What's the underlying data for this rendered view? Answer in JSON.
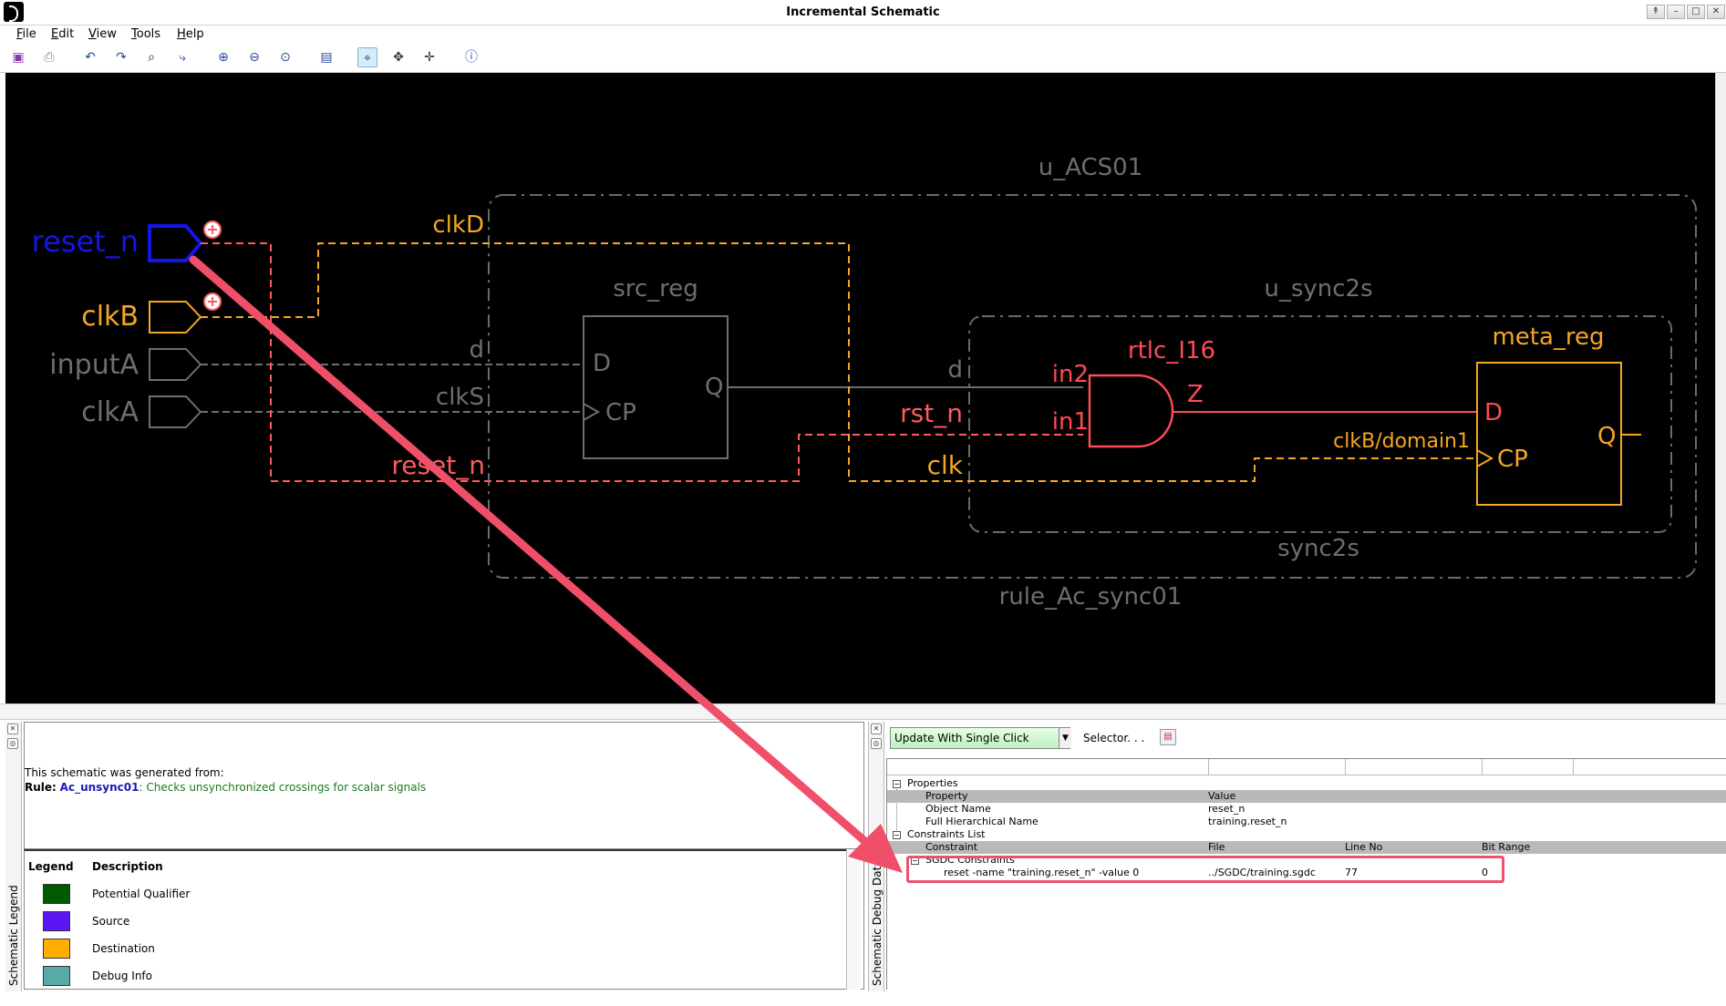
{
  "window": {
    "title": "Incremental Schematic"
  },
  "menu": [
    {
      "label": "File",
      "u": "F",
      "rest": "ile"
    },
    {
      "label": "Edit",
      "u": "E",
      "rest": "dit"
    },
    {
      "label": "View",
      "u": "V",
      "rest": "iew"
    },
    {
      "label": "Tools",
      "u": "T",
      "rest": "ools"
    },
    {
      "label": "Help",
      "u": "H",
      "rest": "elp"
    }
  ],
  "toolbar": {
    "icons": [
      "save-icon",
      "print-icon",
      "undo-icon",
      "redo-icon",
      "find-icon",
      "trace-icon",
      "zoom-in-icon",
      "zoom-out-icon",
      "zoom-fit-icon",
      "window-icon",
      "select-icon",
      "pan-icon",
      "move-icon",
      "info-icon"
    ]
  },
  "schematic": {
    "ports": {
      "reset_n": "reset_n",
      "clkB": "clkB",
      "inputA": "inputA",
      "clkA": "clkA"
    },
    "blocks": {
      "u_acs01": "u_ACS01",
      "rule": "rule_Ac_sync01",
      "u_sync2s": "u_sync2s",
      "sync2s": "sync2s",
      "src_reg": "src_reg",
      "rtlc": "rtlc_I16",
      "meta_reg": "meta_reg"
    },
    "pins": {
      "src_d": "D",
      "src_cp": "CP",
      "src_q": "Q",
      "and_in2": "in2",
      "and_in1": "in1",
      "and_z": "Z",
      "meta_d": "D",
      "meta_cp": "CP",
      "meta_q": "Q"
    },
    "nets": {
      "clkD": "clkD",
      "d1": "d",
      "clkS": "clkS",
      "reset_n": "reset_n",
      "d2": "d",
      "rst_n": "rst_n",
      "clk": "clk",
      "clkB_domain1": "clkB/domain1"
    },
    "colors": {
      "reset": "#ff5a5f",
      "clock": "#f5a623",
      "source": "#1515e8",
      "gray": "#6e6e6e",
      "hier": "#7a7a7a",
      "and_gate": "#ff4b55",
      "meta": "#f5a623"
    }
  },
  "info": {
    "line1": "This schematic was generated from:",
    "rule_prefix": "Rule:",
    "rule_name": "Ac_unsync01",
    "rule_desc": ": Checks unsynchronized crossings for scalar signals"
  },
  "legend": {
    "header_legend": "Legend",
    "header_desc": "Description",
    "rail_label": "Schematic Legend",
    "items": [
      {
        "color": "#005a00",
        "label": "Potential Qualifier"
      },
      {
        "color": "#5a16f5",
        "label": "Source"
      },
      {
        "color": "#ffae00",
        "label": "Destination"
      },
      {
        "color": "#5aa9a9",
        "label": "Debug Info"
      }
    ]
  },
  "debug": {
    "rail_label": "Schematic Debug Data",
    "update_combo": "Update With Single Click",
    "selector_label": "Selector. . .",
    "properties": {
      "section": "Properties",
      "col_property": "Property",
      "col_value": "Value",
      "rows": [
        {
          "name": "Object Name",
          "value": "reset_n"
        },
        {
          "name": "Full Hierarchical Name",
          "value": "training.reset_n"
        }
      ]
    },
    "constraints": {
      "section": "Constraints List",
      "col_constraint": "Constraint",
      "col_file": "File",
      "col_line": "Line No",
      "col_bits": "Bit Range",
      "group": "SGDC Constraints",
      "row": {
        "constraint": "reset -name \"training.reset_n\" -value 0",
        "file": "../SGDC/training.sgdc",
        "line": "77",
        "bits": "0"
      }
    }
  }
}
